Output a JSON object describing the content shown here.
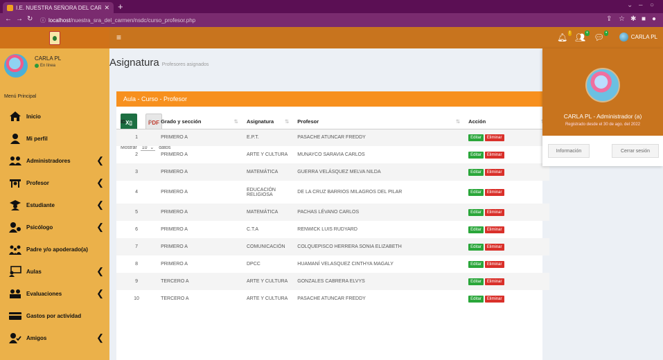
{
  "browser": {
    "tab_title": "I.E. NUESTRA SEÑORA DEL CARN",
    "url_host": "localhost",
    "url_path": "/nuestra_sra_del_carmen/nsdc/curso_profesor.php"
  },
  "topbar": {
    "user_name": "CARLA PL"
  },
  "sidebar": {
    "user_name": "CARLA PL",
    "status": "En línea",
    "menu_header": "Menú Principal",
    "items": [
      {
        "label": "Inicio"
      },
      {
        "label": "Mi perfil"
      },
      {
        "label": "Administradores"
      },
      {
        "label": "Profesor"
      },
      {
        "label": "Estudiante"
      },
      {
        "label": "Psicólogo"
      },
      {
        "label": "Padre y/o apoderado(a)"
      },
      {
        "label": "Aulas"
      },
      {
        "label": "Evaluaciones"
      },
      {
        "label": "Gastos por actividad"
      },
      {
        "label": "Amigos"
      }
    ]
  },
  "page": {
    "title": "Asignatura",
    "subtitle": "Profesores asignados",
    "box_title": "Aula - Curso - Profesor",
    "length_prefix": "Mostrar",
    "length_value": "10",
    "length_suffix": "datos"
  },
  "table": {
    "headers": [
      "ID",
      "Grado y sección",
      "Asignatura",
      "Profesor",
      "Acción"
    ],
    "edit_label": "Editar",
    "delete_label": "Eliminar",
    "rows": [
      {
        "id": "1",
        "grado": "PRIMERO A",
        "asignatura": "E.P.T.",
        "profesor": "PASACHE ATUNCAR FREDDY"
      },
      {
        "id": "2",
        "grado": "PRIMERO A",
        "asignatura": "ARTE Y CULTURA",
        "profesor": "MUNAYCO SARAVIA CARLOS"
      },
      {
        "id": "3",
        "grado": "PRIMERO A",
        "asignatura": "MATEMÁTICA",
        "profesor": "GUERRA VELÁSQUEZ MELVA NILDA"
      },
      {
        "id": "4",
        "grado": "PRIMERO A",
        "asignatura": "EDUCACIÓN RELIGIOSA",
        "profesor": "DE LA CRUZ BARRIOS MILAGROS DEL PILAR"
      },
      {
        "id": "5",
        "grado": "PRIMERO A",
        "asignatura": "MATEMÁTICA",
        "profesor": "PACHAS LÉVANO CARLOS"
      },
      {
        "id": "6",
        "grado": "PRIMERO A",
        "asignatura": "C.T.A",
        "profesor": "RENWICK LUIS RUDYARD"
      },
      {
        "id": "7",
        "grado": "PRIMERO A",
        "asignatura": "COMUNICACIÓN",
        "profesor": "COLQUEPISCO HERRERA SONIA ELIZABETH"
      },
      {
        "id": "8",
        "grado": "PRIMERO A",
        "asignatura": "DPCC",
        "profesor": "HUAMANÍ VELASQUEZ CINTHYA MAGALY"
      },
      {
        "id": "9",
        "grado": "TERCERO A",
        "asignatura": "ARTE Y CULTURA",
        "profesor": "GONZALES CABRERA ELVYS"
      },
      {
        "id": "10",
        "grado": "TERCERO A",
        "asignatura": "ARTE Y CULTURA",
        "profesor": "PASACHE ATUNCAR FREDDY"
      }
    ]
  },
  "dropdown": {
    "name_line": "CARLA PL - Administrador (a)",
    "since_line": "Registrado desde el 30 de ago. del 2022",
    "info_label": "Información",
    "logout_label": "Cerrar sesión"
  },
  "colors": {
    "sidebar": "#ebb14a",
    "topbar": "#c8741e",
    "box_header": "#f7901e",
    "edit": "#2aa63a",
    "delete": "#d9302a"
  }
}
